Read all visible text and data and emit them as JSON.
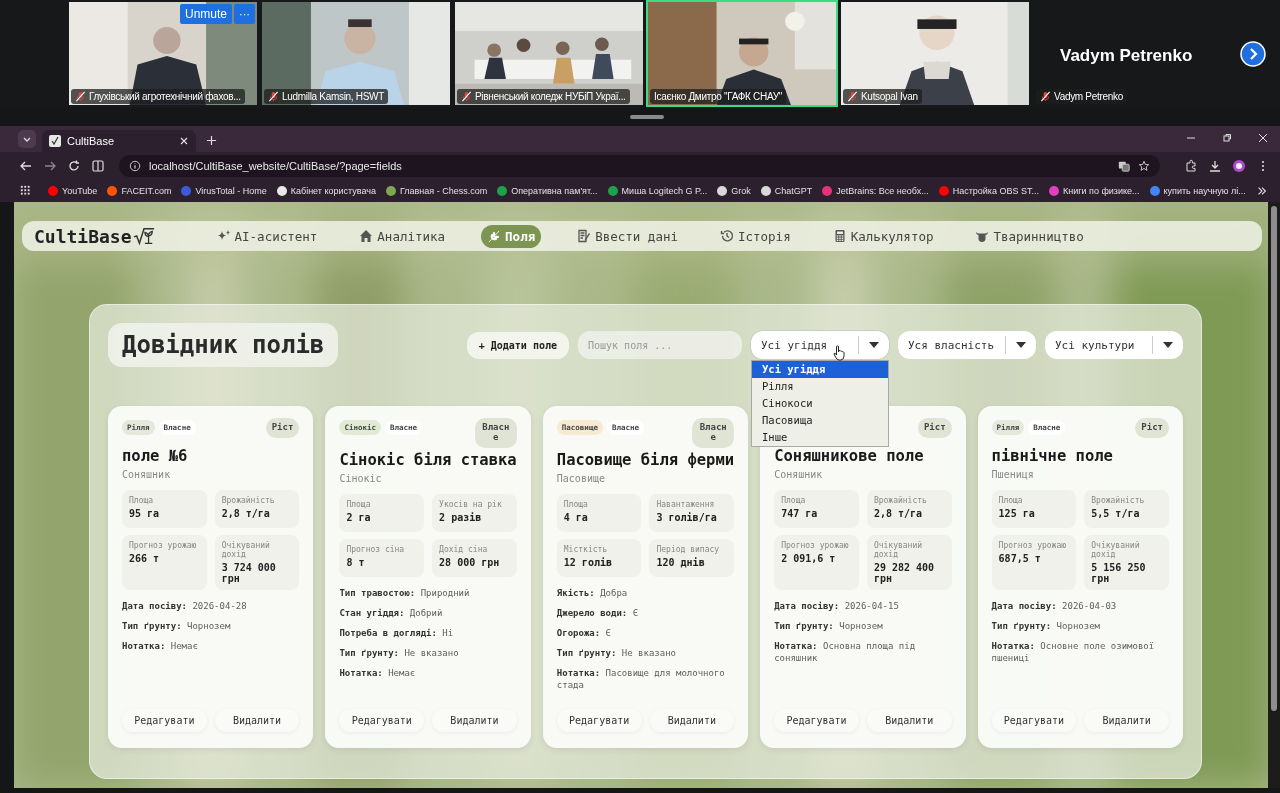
{
  "call": {
    "participants": [
      {
        "kind": "video",
        "name": "Глухівський агротехнічний фахов...",
        "muted": true,
        "speaking": false,
        "buttons": [
          "Unmute",
          "···"
        ]
      },
      {
        "kind": "video",
        "name": "Ludmilla Kamsin, HSWT",
        "muted": true,
        "speaking": false
      },
      {
        "kind": "video",
        "name": "Рівненський коледж НУБіП Украї...",
        "muted": true,
        "speaking": false
      },
      {
        "kind": "video",
        "name": "Ісаєнко Дмитро \"ГАФК СНАУ\"",
        "muted": false,
        "speaking": true
      },
      {
        "kind": "video",
        "name": "Kutsopal Ivan",
        "muted": true,
        "speaking": false
      },
      {
        "kind": "name_only",
        "name": "Vadym Petrenko",
        "muted": true,
        "speaking": false,
        "display_name": "Vadym Petrenko"
      }
    ]
  },
  "browser": {
    "tabs": [
      {
        "title": "CultiBase",
        "selected": true
      }
    ],
    "url": "localhost/CultiBase_website/CultiBase/?page=fields",
    "bookmarks": [
      {
        "label": "YouTube",
        "color": "#ff0000"
      },
      {
        "label": "FACEIT.com",
        "color": "#ff5500"
      },
      {
        "label": "VirusTotal - Home",
        "color": "#3b5bdb"
      },
      {
        "label": "Кабінет користувача",
        "color": "#e8e8e8"
      },
      {
        "label": "Главная - Chess.com",
        "color": "#7fa650"
      },
      {
        "label": "Оперативна пам'ят...",
        "color": "#1fa04a"
      },
      {
        "label": "Миша Logitech G P...",
        "color": "#1fa04a"
      },
      {
        "label": "Grok",
        "color": "#d8d8d8"
      },
      {
        "label": "ChatGPT",
        "color": "#d8d8d8"
      },
      {
        "label": "JetBrains: Все необх...",
        "color": "#e5337a"
      },
      {
        "label": "Настройка OBS ST...",
        "color": "#ff0000"
      },
      {
        "label": "Книги по физике...",
        "color": "#e040c0"
      },
      {
        "label": "купить научную лі...",
        "color": "#4285f4"
      }
    ]
  },
  "app": {
    "logo": "CultiBase",
    "nav": [
      {
        "label": "AI-асистент",
        "selected": false
      },
      {
        "label": "Аналітика",
        "selected": false
      },
      {
        "label": "Поля",
        "selected": true
      },
      {
        "label": "Ввести дані",
        "selected": false
      },
      {
        "label": "Історія",
        "selected": false
      },
      {
        "label": "Калькулятор",
        "selected": false
      },
      {
        "label": "Тваринництво",
        "selected": false
      }
    ],
    "panel": {
      "title": "Довідник полів",
      "add_button": "+ Додати поле",
      "search": {
        "placeholder": "Пошук поля ..."
      },
      "filters": [
        {
          "value": "Усі угіддя",
          "expanded": true,
          "options": [
            {
              "label": "Усі угіддя",
              "selected": true
            },
            {
              "label": "Рілля",
              "selected": false
            },
            {
              "label": "Сінокоси",
              "selected": false
            },
            {
              "label": "Пасовища",
              "selected": false
            },
            {
              "label": "Інше",
              "selected": false
            }
          ]
        },
        {
          "value": "Уся власність",
          "expanded": false
        },
        {
          "value": "Усі культури",
          "expanded": false
        }
      ],
      "cards": [
        {
          "tags": [
            {
              "label": "Рілля",
              "color": "#e4e9dc"
            },
            {
              "label": "Власне",
              "color": "#ffffff"
            }
          ],
          "badge": "Ріст",
          "title": "поле №6",
          "subtitle": "Соняшник",
          "stats": [
            {
              "label": "Площа",
              "value": "95 га"
            },
            {
              "label": "Врожайність",
              "value": "2,8 т/га"
            },
            {
              "label": "Прогноз урожаю",
              "value": "266 т"
            },
            {
              "label": "Очікуваний дохід",
              "value": "3 724 000 грн"
            }
          ],
          "details": [
            {
              "label": "Дата посіву:",
              "value": "2026-04-28"
            },
            {
              "label": "Тип ґрунту:",
              "value": "Чорнозем"
            },
            {
              "label": "Нотатка:",
              "value": "Немає"
            }
          ],
          "edit": "Редагувати",
          "delete": "Видалити"
        },
        {
          "tags": [
            {
              "label": "Сінокіс",
              "color": "#e1ebd3"
            },
            {
              "label": "Власне",
              "color": "#ffffff"
            }
          ],
          "badge": "Власне",
          "title": "Сінокіс біля ставка",
          "subtitle": "Сінокіс",
          "stats": [
            {
              "label": "Площа",
              "value": "2 га"
            },
            {
              "label": "Укосів на рік",
              "value": "2 разів"
            },
            {
              "label": "Прогноз сіна",
              "value": "8 т"
            },
            {
              "label": "Дохід сіна",
              "value": "28 000 грн"
            }
          ],
          "details": [
            {
              "label": "Тип травостою:",
              "value": "Природний"
            },
            {
              "label": "Стан угіддя:",
              "value": "Добрий"
            },
            {
              "label": "Потреба в догляді:",
              "value": "Ні"
            },
            {
              "label": "Тип ґрунту:",
              "value": "Не вказано"
            },
            {
              "label": "Нотатка:",
              "value": "Немає"
            }
          ],
          "edit": "Редагувати",
          "delete": "Видалити"
        },
        {
          "tags": [
            {
              "label": "Пасовище",
              "color": "#f6ead2"
            },
            {
              "label": "Власне",
              "color": "#ffffff"
            }
          ],
          "badge": "Власне",
          "title": "Пасовище біля ферми",
          "subtitle": "Пасовище",
          "stats": [
            {
              "label": "Площа",
              "value": "4 га"
            },
            {
              "label": "Навантаження",
              "value": "3 голів/га"
            },
            {
              "label": "Місткість",
              "value": "12 голів"
            },
            {
              "label": "Період випасу",
              "value": "120 днів"
            }
          ],
          "details": [
            {
              "label": "Якість:",
              "value": "Добра"
            },
            {
              "label": "Джерело води:",
              "value": "Є"
            },
            {
              "label": "Огорожа:",
              "value": "Є"
            },
            {
              "label": "Тип ґрунту:",
              "value": "Не вказано"
            },
            {
              "label": "Нотатка:",
              "value": "Пасовище для молочного стада"
            }
          ],
          "edit": "Редагувати",
          "delete": "Видалити"
        },
        {
          "badge": "Ріст",
          "title": "Соняшникове поле",
          "subtitle": "Соняшник",
          "stats": [
            {
              "label": "Площа",
              "value": "747 га"
            },
            {
              "label": "Врожайність",
              "value": "2,8 т/га"
            },
            {
              "label": "Прогноз урожаю",
              "value": "2 091,6 т"
            },
            {
              "label": "Очікуваний дохід",
              "value": "29 282 400 грн"
            }
          ],
          "details": [
            {
              "label": "Дата посіву:",
              "value": "2026-04-15"
            },
            {
              "label": "Тип ґрунту:",
              "value": "Чорнозем"
            },
            {
              "label": "Нотатка:",
              "value": "Основна площа під соняшник"
            }
          ],
          "edit": "Редагувати",
          "delete": "Видалити"
        },
        {
          "tags": [
            {
              "label": "Рілля",
              "color": "#e4e9dc"
            },
            {
              "label": "Власне",
              "color": "#ffffff"
            }
          ],
          "badge": "Ріст",
          "title": "північне поле",
          "subtitle": "Пшениця",
          "stats": [
            {
              "label": "Площа",
              "value": "125 га"
            },
            {
              "label": "Врожайність",
              "value": "5,5 т/га"
            },
            {
              "label": "Прогноз урожаю",
              "value": "687,5 т"
            },
            {
              "label": "Очікуваний дохід",
              "value": "5 156 250 грн"
            }
          ],
          "details": [
            {
              "label": "Дата посіву:",
              "value": "2026-04-03"
            },
            {
              "label": "Тип ґрунту:",
              "value": "Чорнозем"
            },
            {
              "label": "Нотатка:",
              "value": "Основне поле озимової пшениці"
            }
          ],
          "edit": "Редагувати",
          "delete": "Видалити"
        }
      ]
    }
  }
}
